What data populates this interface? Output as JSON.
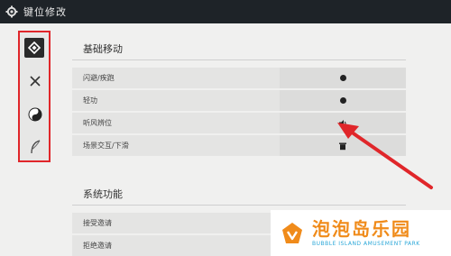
{
  "header": {
    "title": "键位修改"
  },
  "sidebar": {
    "items": [
      {
        "icon": "diamond-icon",
        "active": true
      },
      {
        "icon": "swords-icon",
        "active": false
      },
      {
        "icon": "yin-yang-icon",
        "active": false
      },
      {
        "icon": "feather-icon",
        "active": false
      }
    ]
  },
  "sections": [
    {
      "title": "基础移动",
      "rows": [
        {
          "label": "闪避/疾跑",
          "key_icon": "dot"
        },
        {
          "label": "轻功",
          "key_icon": "dot"
        },
        {
          "label": "听风辨位",
          "key_icon": "speaker-icon"
        },
        {
          "label": "场景交互/下滑",
          "key_icon": "trash-icon"
        }
      ]
    },
    {
      "title": "系统功能",
      "rows": [
        {
          "label": "接受邀请",
          "key_icon": "dot"
        },
        {
          "label": "拒绝邀请",
          "key_icon": "dot"
        }
      ]
    }
  ],
  "watermark": {
    "cn": "泡泡岛乐园",
    "en": "BUBBLE ISLAND AMUSEMENT PARK"
  },
  "colors": {
    "highlight_red": "#e0262a",
    "brand_orange": "#f08b1a",
    "brand_blue": "#2aa7d8"
  }
}
